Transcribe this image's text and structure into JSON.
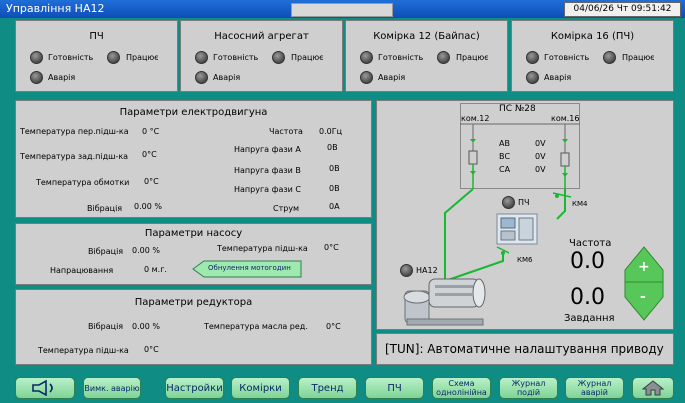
{
  "window": {
    "title": "Управління НА12",
    "datetime": "04/06/26 Чт 09:51:42"
  },
  "status_panels": [
    {
      "title": "ПЧ",
      "items": [
        "Готовність",
        "Працює",
        "Аварія"
      ]
    },
    {
      "title": "Насосний агрегат",
      "items": [
        "Готовність",
        "Працює",
        "Аварія"
      ]
    },
    {
      "title": "Комірка 12 (Байпас)",
      "items": [
        "Готовність",
        "Працює",
        "Аварія"
      ]
    },
    {
      "title": "Комірка 16 (ПЧ)",
      "items": [
        "Готовність",
        "Працює",
        "Аварія"
      ]
    }
  ],
  "motor": {
    "title": "Параметри електродвигуна",
    "rows": [
      {
        "label": "Температура пер.підш-ка",
        "value": "0 °C"
      },
      {
        "label": "Температура зад.підш-ка",
        "value": "0°C"
      },
      {
        "label": "Температура обмотки",
        "value": "0°C"
      },
      {
        "label": "Вібрація",
        "value": "0.00 %"
      }
    ],
    "right_rows": [
      {
        "label": "Частота",
        "value": "0.0Гц"
      },
      {
        "label": "Напруга фази А",
        "value": "0В"
      },
      {
        "label": "Напруга фази В",
        "value": "0В"
      },
      {
        "label": "Напруга фази С",
        "value": "0В"
      },
      {
        "label": "Струм",
        "value": "0А"
      }
    ]
  },
  "pump": {
    "title": "Параметри насосу",
    "vibration_label": "Вібрація",
    "vibration_value": "0.00 %",
    "temp_label": "Температура підш-ка",
    "temp_value": "0°C",
    "runtime_label": "Напрацювання",
    "runtime_value": "0 м.г.",
    "reset_button": "Обнулення мотогодин"
  },
  "reducer": {
    "title": "Параметри редуктора",
    "vibration_label": "Вібрація",
    "vibration_value": "0.00 %",
    "oil_label": "Температура масла ред.",
    "oil_value": "0°C",
    "bearing_label": "Температура підш-ка",
    "bearing_value": "0°C"
  },
  "diagram": {
    "ps_title": "ПС №28",
    "km12": "ком.12",
    "km16": "ком.16",
    "phases": [
      {
        "name": "АВ",
        "value": "0V"
      },
      {
        "name": "ВС",
        "value": "0V"
      },
      {
        "name": "СА",
        "value": "0V"
      }
    ],
    "pch_label": "ПЧ",
    "km4": "КМ4",
    "km6": "КМ6",
    "na12": "НА12",
    "freq_label": "Частота",
    "freq_value": "0.0",
    "set_value": "0.0",
    "set_label": "Завдання",
    "plus": "+",
    "minus": "-"
  },
  "status_message": "[TUN]: Автоматичне налаштування приводу",
  "toolbar": {
    "mute": "Вимк. аварію",
    "settings": "Настройки",
    "cells": "Комірки",
    "trend": "Тренд",
    "pch": "ПЧ",
    "scheme": "Схема однолінійна",
    "events": "Журнал подій",
    "alarms": "Журнал аварій"
  },
  "colors": {
    "background": "#0f8c84",
    "panel": "#cfcfcf",
    "button": "#8fdca6",
    "wire": "#19b832",
    "arrow_green": "#3fbf3f"
  }
}
